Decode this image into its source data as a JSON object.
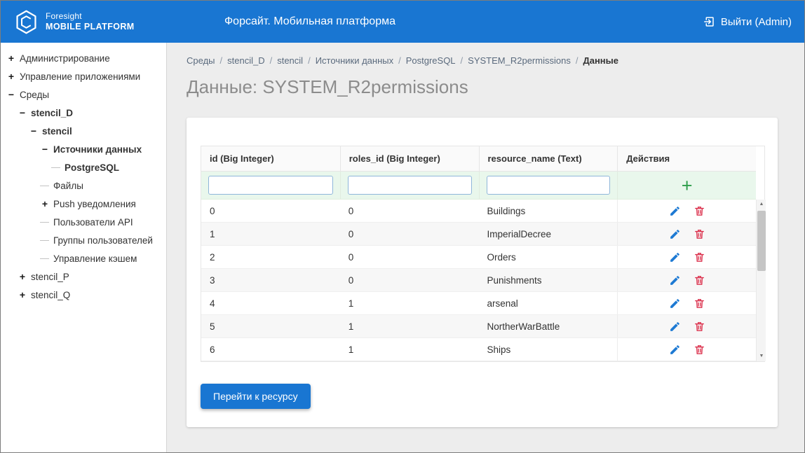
{
  "header": {
    "logo": {
      "line1": "Foresight",
      "line2": "MOBILE PLATFORM"
    },
    "app_title": "Форсайт. Мобильная платформа",
    "logout": {
      "label": "Выйти (Admin)"
    }
  },
  "sidebar": {
    "tree": [
      {
        "label": "Администрирование",
        "level": 0,
        "toggle": "expand",
        "bold": false
      },
      {
        "label": "Управление приложениями",
        "level": 0,
        "toggle": "expand",
        "bold": false
      },
      {
        "label": "Среды",
        "level": 0,
        "toggle": "collapse",
        "bold": false
      },
      {
        "label": "stencil_D",
        "level": 1,
        "toggle": "collapse",
        "bold": true
      },
      {
        "label": "stencil",
        "level": 2,
        "toggle": "collapse",
        "bold": true
      },
      {
        "label": "Источники данных",
        "level": 3,
        "toggle": "collapse",
        "bold": true
      },
      {
        "label": "PostgreSQL",
        "level": 4,
        "toggle": "none",
        "bold": true
      },
      {
        "label": "Файлы",
        "level": 3,
        "toggle": "none",
        "bold": false
      },
      {
        "label": "Push уведомления",
        "level": 3,
        "toggle": "expand",
        "bold": false
      },
      {
        "label": "Пользователи API",
        "level": 3,
        "toggle": "none",
        "bold": false
      },
      {
        "label": "Группы пользователей",
        "level": 3,
        "toggle": "none",
        "bold": false
      },
      {
        "label": "Управление кэшем",
        "level": 3,
        "toggle": "none",
        "bold": false
      },
      {
        "label": "stencil_P",
        "level": 1,
        "toggle": "expand",
        "bold": false
      },
      {
        "label": "stencil_Q",
        "level": 1,
        "toggle": "expand",
        "bold": false
      }
    ]
  },
  "breadcrumb": [
    "Среды",
    "stencil_D",
    "stencil",
    "Источники данных",
    "PostgreSQL",
    "SYSTEM_R2permissions",
    "Данные"
  ],
  "page": {
    "title": "Данные: SYSTEM_R2permissions"
  },
  "data_table": {
    "columns": [
      "id (Big Integer)",
      "roles_id (Big Integer)",
      "resource_name (Text)",
      "Действия"
    ],
    "filters": {
      "id": "",
      "roles_id": "",
      "resource_name": ""
    },
    "filter_placeholders": {
      "id": "",
      "roles_id": "",
      "resource_name": ""
    },
    "add_icon": "+",
    "rows": [
      {
        "id": "0",
        "roles_id": "0",
        "resource_name": "Buildings"
      },
      {
        "id": "1",
        "roles_id": "0",
        "resource_name": "ImperialDecree"
      },
      {
        "id": "2",
        "roles_id": "0",
        "resource_name": "Orders"
      },
      {
        "id": "3",
        "roles_id": "0",
        "resource_name": "Punishments"
      },
      {
        "id": "4",
        "roles_id": "1",
        "resource_name": "arsenal"
      },
      {
        "id": "5",
        "roles_id": "1",
        "resource_name": "NortherWarBattle"
      },
      {
        "id": "6",
        "roles_id": "1",
        "resource_name": "Ships"
      }
    ]
  },
  "actions": {
    "go_to_resource": "Перейти к ресурсу"
  },
  "colors": {
    "header_blue": "#1976d2",
    "edit_blue": "#1e7ad3",
    "delete_red": "#dc3550",
    "accent_green": "#2e9e4b",
    "filter_row_green": "#e9f7ec"
  }
}
